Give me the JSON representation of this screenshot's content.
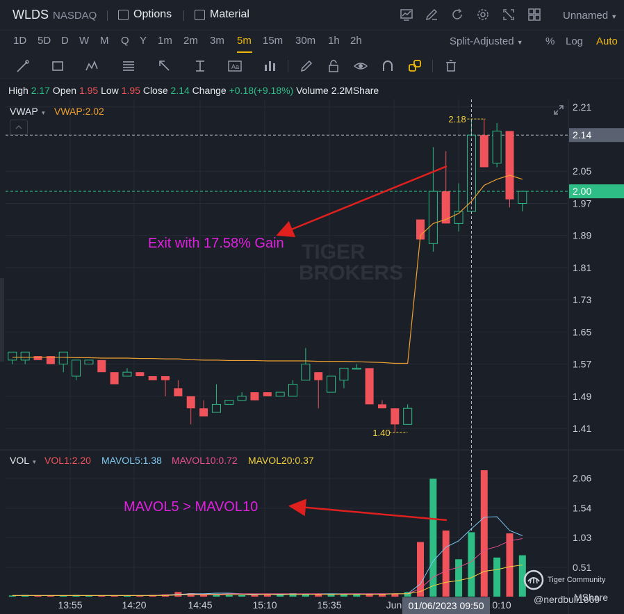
{
  "topbar": {
    "ticker": "WLDS",
    "exchange": "NASDAQ",
    "options_label": "Options",
    "material_label": "Material",
    "layout_name": "Unnamed",
    "icons": [
      "chart-icon",
      "draw-icon",
      "refresh-icon",
      "settings-icon",
      "fullscreen-icon",
      "grid-icon"
    ]
  },
  "timeframes": {
    "items": [
      "1D",
      "5D",
      "D",
      "W",
      "M",
      "Q",
      "Y",
      "1m",
      "2m",
      "3m",
      "5m",
      "15m",
      "30m",
      "1h",
      "2h"
    ],
    "active": "5m",
    "adjust": "Split-Adjusted",
    "percent": "%",
    "log": "Log",
    "auto": "Auto"
  },
  "drawing_tools": [
    "line-tool-icon",
    "rectangle-tool-icon",
    "pattern-tool-icon",
    "fib-tool-icon",
    "arrow-tool-icon",
    "measure-tool-icon",
    "text-tool-icon",
    "indicator-icon",
    "pencil-icon",
    "lock-icon",
    "eye-icon",
    "magnet-icon",
    "link-icon",
    "trash-icon"
  ],
  "ohlc": {
    "high_label": "High",
    "high": "2.17",
    "open_label": "Open",
    "open": "1.95",
    "low_label": "Low",
    "low": "1.95",
    "close_label": "Close",
    "close": "2.14",
    "change_label": "Change",
    "change": "+0.18(+9.18%)",
    "volume_label": "Volume",
    "volume": "2.2MShare"
  },
  "vwap": {
    "label": "VWAP",
    "value": "VWAP:2.02"
  },
  "volume_legend": {
    "label": "VOL",
    "vol1": "VOL1:2.20",
    "mavol5": "MAVOL5:1.38",
    "mavol10": "MAVOL10:0.72",
    "mavol20": "MAVOL20:0.37"
  },
  "annotations": {
    "exit": "Exit with 17.58% Gain",
    "mavol": "MAVOL5 > MAVOL10"
  },
  "watermark": {
    "line1": "TIGER",
    "line2": "BROKERS"
  },
  "branding": {
    "community": "Tiger Community",
    "handle": "@nerdbull1669",
    "share_unit": "MShare"
  },
  "colors": {
    "up": "#2ebd85",
    "down": "#f05359",
    "vwap": "#f0a030",
    "accent": "#f0b90b",
    "annot": "#e020e0",
    "arrow": "#e0201e"
  },
  "chart_data": {
    "type": "candlestick",
    "price_axis_ticks": [
      "2.21",
      "2.14",
      "2.05",
      "2.00",
      "1.97",
      "1.89",
      "1.81",
      "1.73",
      "1.65",
      "1.57",
      "1.49",
      "1.41"
    ],
    "price_range": [
      1.36,
      2.22
    ],
    "current_price_label": "2.14",
    "last_price_label": "2.00",
    "high_marker": "2.18",
    "low_marker": "1.40",
    "time_ticks": [
      "13:55",
      "14:20",
      "14:45",
      "15:10",
      "15:35",
      "Jun",
      "01/06/2023 09:50",
      "0:10"
    ],
    "candles": [
      {
        "o": 1.58,
        "h": 1.6,
        "l": 1.57,
        "c": 1.6
      },
      {
        "o": 1.58,
        "h": 1.6,
        "l": 1.57,
        "c": 1.6
      },
      {
        "o": 1.59,
        "h": 1.59,
        "l": 1.58,
        "c": 1.58
      },
      {
        "o": 1.59,
        "h": 1.59,
        "l": 1.57,
        "c": 1.57
      },
      {
        "o": 1.57,
        "h": 1.6,
        "l": 1.55,
        "c": 1.6
      },
      {
        "o": 1.54,
        "h": 1.58,
        "l": 1.53,
        "c": 1.58
      },
      {
        "o": 1.57,
        "h": 1.58,
        "l": 1.57,
        "c": 1.58
      },
      {
        "o": 1.58,
        "h": 1.58,
        "l": 1.55,
        "c": 1.55
      },
      {
        "o": 1.55,
        "h": 1.55,
        "l": 1.52,
        "c": 1.52
      },
      {
        "o": 1.54,
        "h": 1.56,
        "l": 1.54,
        "c": 1.55
      },
      {
        "o": 1.55,
        "h": 1.55,
        "l": 1.54,
        "c": 1.54
      },
      {
        "o": 1.54,
        "h": 1.54,
        "l": 1.53,
        "c": 1.53
      },
      {
        "o": 1.54,
        "h": 1.54,
        "l": 1.49,
        "c": 1.53
      },
      {
        "o": 1.51,
        "h": 1.53,
        "l": 1.49,
        "c": 1.49
      },
      {
        "o": 1.49,
        "h": 1.49,
        "l": 1.42,
        "c": 1.46
      },
      {
        "o": 1.46,
        "h": 1.48,
        "l": 1.44,
        "c": 1.44
      },
      {
        "o": 1.45,
        "h": 1.52,
        "l": 1.45,
        "c": 1.47
      },
      {
        "o": 1.47,
        "h": 1.48,
        "l": 1.47,
        "c": 1.48
      },
      {
        "o": 1.48,
        "h": 1.5,
        "l": 1.48,
        "c": 1.49
      },
      {
        "o": 1.5,
        "h": 1.5,
        "l": 1.48,
        "c": 1.48
      },
      {
        "o": 1.5,
        "h": 1.5,
        "l": 1.49,
        "c": 1.49
      },
      {
        "o": 1.49,
        "h": 1.5,
        "l": 1.49,
        "c": 1.5
      },
      {
        "o": 1.49,
        "h": 1.53,
        "l": 1.49,
        "c": 1.52
      },
      {
        "o": 1.53,
        "h": 1.61,
        "l": 1.53,
        "c": 1.57
      },
      {
        "o": 1.55,
        "h": 1.55,
        "l": 1.46,
        "c": 1.53
      },
      {
        "o": 1.5,
        "h": 1.54,
        "l": 1.5,
        "c": 1.54
      },
      {
        "o": 1.53,
        "h": 1.56,
        "l": 1.51,
        "c": 1.56
      },
      {
        "o": 1.56,
        "h": 1.57,
        "l": 1.56,
        "c": 1.56
      },
      {
        "o": 1.56,
        "h": 1.56,
        "l": 1.47,
        "c": 1.47
      },
      {
        "o": 1.47,
        "h": 1.48,
        "l": 1.46,
        "c": 1.46
      },
      {
        "o": 1.46,
        "h": 1.46,
        "l": 1.4,
        "c": 1.42
      },
      {
        "o": 1.42,
        "h": 1.47,
        "l": 1.42,
        "c": 1.46
      },
      {
        "o": 1.93,
        "h": 1.93,
        "l": 1.88,
        "c": 1.88
      },
      {
        "o": 1.87,
        "h": 2.11,
        "l": 1.85,
        "c": 2.0
      },
      {
        "o": 2.0,
        "h": 2.1,
        "l": 1.92,
        "c": 1.92
      },
      {
        "o": 1.92,
        "h": 2.02,
        "l": 1.9,
        "c": 1.95
      },
      {
        "o": 1.95,
        "h": 2.18,
        "l": 1.95,
        "c": 2.14
      },
      {
        "o": 2.14,
        "h": 2.18,
        "l": 2.06,
        "c": 2.06
      },
      {
        "o": 2.07,
        "h": 2.17,
        "l": 2.06,
        "c": 2.15
      },
      {
        "o": 2.15,
        "h": 2.15,
        "l": 1.96,
        "c": 1.98
      },
      {
        "o": 1.97,
        "h": 2.0,
        "l": 1.95,
        "c": 2.0
      }
    ],
    "vwap": [
      1.587,
      1.587,
      1.587,
      1.587,
      1.587,
      1.586,
      1.586,
      1.585,
      1.585,
      1.585,
      1.584,
      1.584,
      1.583,
      1.583,
      1.581,
      1.58,
      1.58,
      1.579,
      1.579,
      1.579,
      1.578,
      1.578,
      1.578,
      1.578,
      1.577,
      1.577,
      1.577,
      1.576,
      1.575,
      1.574,
      1.572,
      1.572,
      1.89,
      1.92,
      1.93,
      1.945,
      1.975,
      2.015,
      2.03,
      2.04,
      2.03
    ],
    "volume": {
      "axis_ticks": [
        "2.06",
        "1.54",
        "1.03",
        "0.51"
      ],
      "range": [
        0,
        2.25
      ],
      "values": [
        0.02,
        0.03,
        0.02,
        0.02,
        0.02,
        0.03,
        0.02,
        0.02,
        0.02,
        0.02,
        0.02,
        0.03,
        0.04,
        0.08,
        0.06,
        0.05,
        0.05,
        0.04,
        0.03,
        0.03,
        0.03,
        0.04,
        0.06,
        0.05,
        0.05,
        0.04,
        0.05,
        0.04,
        0.05,
        0.04,
        0.05,
        0.08,
        0.95,
        2.05,
        1.15,
        0.65,
        1.12,
        2.2,
        0.68,
        1.1,
        0.72
      ],
      "mavol5": [
        0.02,
        0.02,
        0.02,
        0.02,
        0.02,
        0.02,
        0.02,
        0.02,
        0.02,
        0.02,
        0.02,
        0.02,
        0.03,
        0.04,
        0.05,
        0.05,
        0.06,
        0.06,
        0.05,
        0.04,
        0.04,
        0.03,
        0.04,
        0.04,
        0.05,
        0.05,
        0.05,
        0.05,
        0.05,
        0.05,
        0.05,
        0.05,
        0.22,
        0.62,
        0.86,
        0.97,
        1.18,
        1.38,
        1.39,
        1.15,
        1.06
      ],
      "mavol10": [
        0.02,
        0.02,
        0.02,
        0.02,
        0.02,
        0.02,
        0.02,
        0.02,
        0.02,
        0.02,
        0.02,
        0.02,
        0.03,
        0.03,
        0.04,
        0.04,
        0.04,
        0.05,
        0.05,
        0.05,
        0.05,
        0.05,
        0.05,
        0.05,
        0.05,
        0.04,
        0.05,
        0.05,
        0.05,
        0.05,
        0.05,
        0.05,
        0.14,
        0.34,
        0.45,
        0.51,
        0.61,
        0.81,
        0.87,
        0.97,
        1.01
      ],
      "mavol20": [
        0.02,
        0.02,
        0.02,
        0.02,
        0.02,
        0.02,
        0.02,
        0.02,
        0.02,
        0.02,
        0.02,
        0.02,
        0.02,
        0.03,
        0.03,
        0.03,
        0.03,
        0.03,
        0.03,
        0.03,
        0.04,
        0.04,
        0.04,
        0.04,
        0.04,
        0.04,
        0.04,
        0.04,
        0.04,
        0.04,
        0.05,
        0.05,
        0.09,
        0.19,
        0.25,
        0.28,
        0.33,
        0.44,
        0.47,
        0.52,
        0.55
      ]
    }
  }
}
